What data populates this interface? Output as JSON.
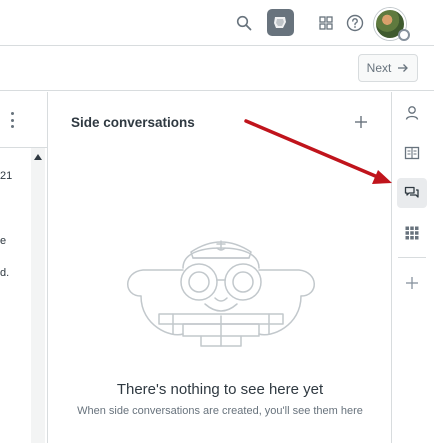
{
  "topbar": {
    "icons": [
      "search-icon",
      "product-logo-icon",
      "apps-grid-icon",
      "help-icon",
      "user-avatar"
    ]
  },
  "subbar": {
    "next_label": "Next"
  },
  "left_column": {
    "fragments": [
      "21",
      "e",
      "d."
    ]
  },
  "side_panel": {
    "title": "Side conversations",
    "empty_title": "There's nothing to see here yet",
    "empty_subtitle": "When side conversations are created, you'll see them here"
  },
  "rail": {
    "items": [
      "user-icon",
      "knowledge-icon",
      "side-conversations-icon",
      "apps-icon",
      "add-icon"
    ],
    "active": "side-conversations-icon"
  },
  "colors": {
    "annotation_arrow": "#c0141c",
    "active_rail_bg": "#e9ebed",
    "illustration_stroke": "#c2c8cc"
  }
}
